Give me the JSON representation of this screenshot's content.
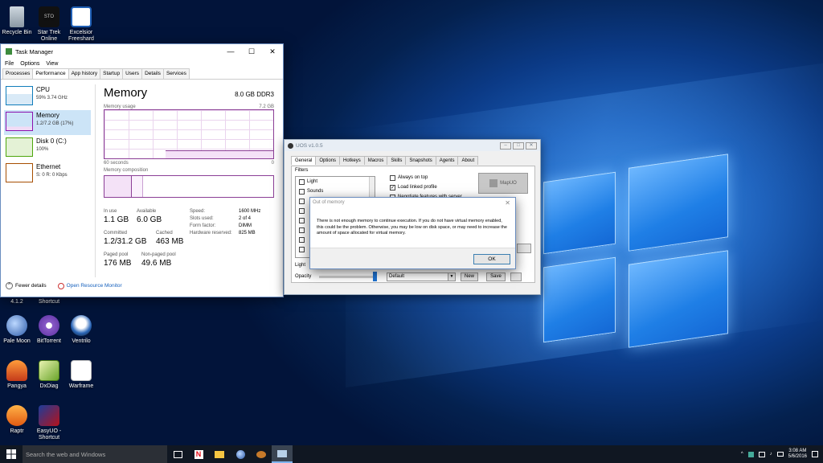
{
  "desktop": {
    "icons_top": [
      {
        "label": "Recycle Bin",
        "icon": "recycle-bin-icon"
      },
      {
        "label": "Star Trek Online",
        "icon": "star-trek-online-icon"
      },
      {
        "label": "Excelsior Freeshard",
        "icon": "excelsior-icon"
      }
    ],
    "partial_labels": [
      "4.1.2",
      "Shortcut"
    ],
    "icons_bottom": [
      {
        "label": "Pale Moon",
        "icon": "pale-moon-icon"
      },
      {
        "label": "BitTorrent",
        "icon": "bittorrent-icon"
      },
      {
        "label": "Ventrilo",
        "icon": "ventrilo-icon"
      },
      {
        "label": "Pangya",
        "icon": "pangya-icon"
      },
      {
        "label": "DxDiag",
        "icon": "dxdiag-icon"
      },
      {
        "label": "Warframe",
        "icon": "warframe-icon"
      },
      {
        "label": "Raptr",
        "icon": "raptr-icon"
      },
      {
        "label": "EasyUO - Shortcut",
        "icon": "easyuo-icon"
      }
    ]
  },
  "task_manager": {
    "title": "Task Manager",
    "menu": [
      "File",
      "Options",
      "View"
    ],
    "tabs": [
      "Processes",
      "Performance",
      "App history",
      "Startup",
      "Users",
      "Details",
      "Services"
    ],
    "active_tab": "Performance",
    "resources": [
      {
        "name": "CPU",
        "detail": "59% 3.74 GHz",
        "color": "#117dbb"
      },
      {
        "name": "Memory",
        "detail": "1.2/7.2 GB (17%)",
        "color": "#8b12ae"
      },
      {
        "name": "Disk 0 (C:)",
        "detail": "100%",
        "color": "#4da60c"
      },
      {
        "name": "Ethernet",
        "detail": "S: 0 R: 0 Kbps",
        "color": "#a74f01"
      }
    ],
    "selected_resource": "Memory",
    "panel": {
      "heading": "Memory",
      "spec": "8.0 GB DDR3",
      "usage_label": "Memory usage",
      "usage_max": "7.2 GB",
      "time_left": "60 seconds",
      "time_right": "0",
      "composition_label": "Memory composition",
      "usage_fraction": 0.17,
      "stats": {
        "in_use_label": "In use",
        "in_use": "1.1 GB",
        "available_label": "Available",
        "available": "6.0 GB",
        "committed_label": "Committed",
        "committed": "1.2/31.2 GB",
        "cached_label": "Cached",
        "cached": "463 MB",
        "paged_label": "Paged pool",
        "paged": "176 MB",
        "nonpaged_label": "Non-paged pool",
        "nonpaged": "49.6 MB"
      },
      "specs": [
        {
          "k": "Speed:",
          "v": "1600 MHz"
        },
        {
          "k": "Slots used:",
          "v": "2 of 4"
        },
        {
          "k": "Form factor:",
          "v": "DIMM"
        },
        {
          "k": "Hardware reserved:",
          "v": "825 MB"
        }
      ]
    },
    "footer": {
      "fewer": "Fewer details",
      "monitor": "Open Resource Monitor"
    }
  },
  "uos": {
    "title": "UOS v1.0.5",
    "tabs": [
      "General",
      "Options",
      "Hotkeys",
      "Macros",
      "Skills",
      "Snapshots",
      "Agents",
      "About"
    ],
    "active_tab": "General",
    "filters_label": "Filters",
    "filters": [
      "Light",
      "Sounds"
    ],
    "options": [
      {
        "label": "Always on top",
        "checked": false
      },
      {
        "label": "Load linked profile",
        "checked": true
      },
      {
        "label": "Negotiate features with server",
        "checked": false
      }
    ],
    "mapuo": "MapUO",
    "light_label": "Light",
    "opacity_label": "Opacity",
    "profile": "Default",
    "new_btn": "New",
    "save_btn": "Save"
  },
  "dialog": {
    "title": "Out of memory",
    "message": "There is not enough memory to continue execution.  If you do not have virtual memory enabled, this could be the problem. Otherwise, you may be low on disk space, or may need to increase the amount of space allocated for virtual memory.",
    "ok": "OK"
  },
  "taskbar": {
    "search_placeholder": "Search the web and Windows",
    "time": "3:08 AM",
    "date": "5/6/2016"
  }
}
